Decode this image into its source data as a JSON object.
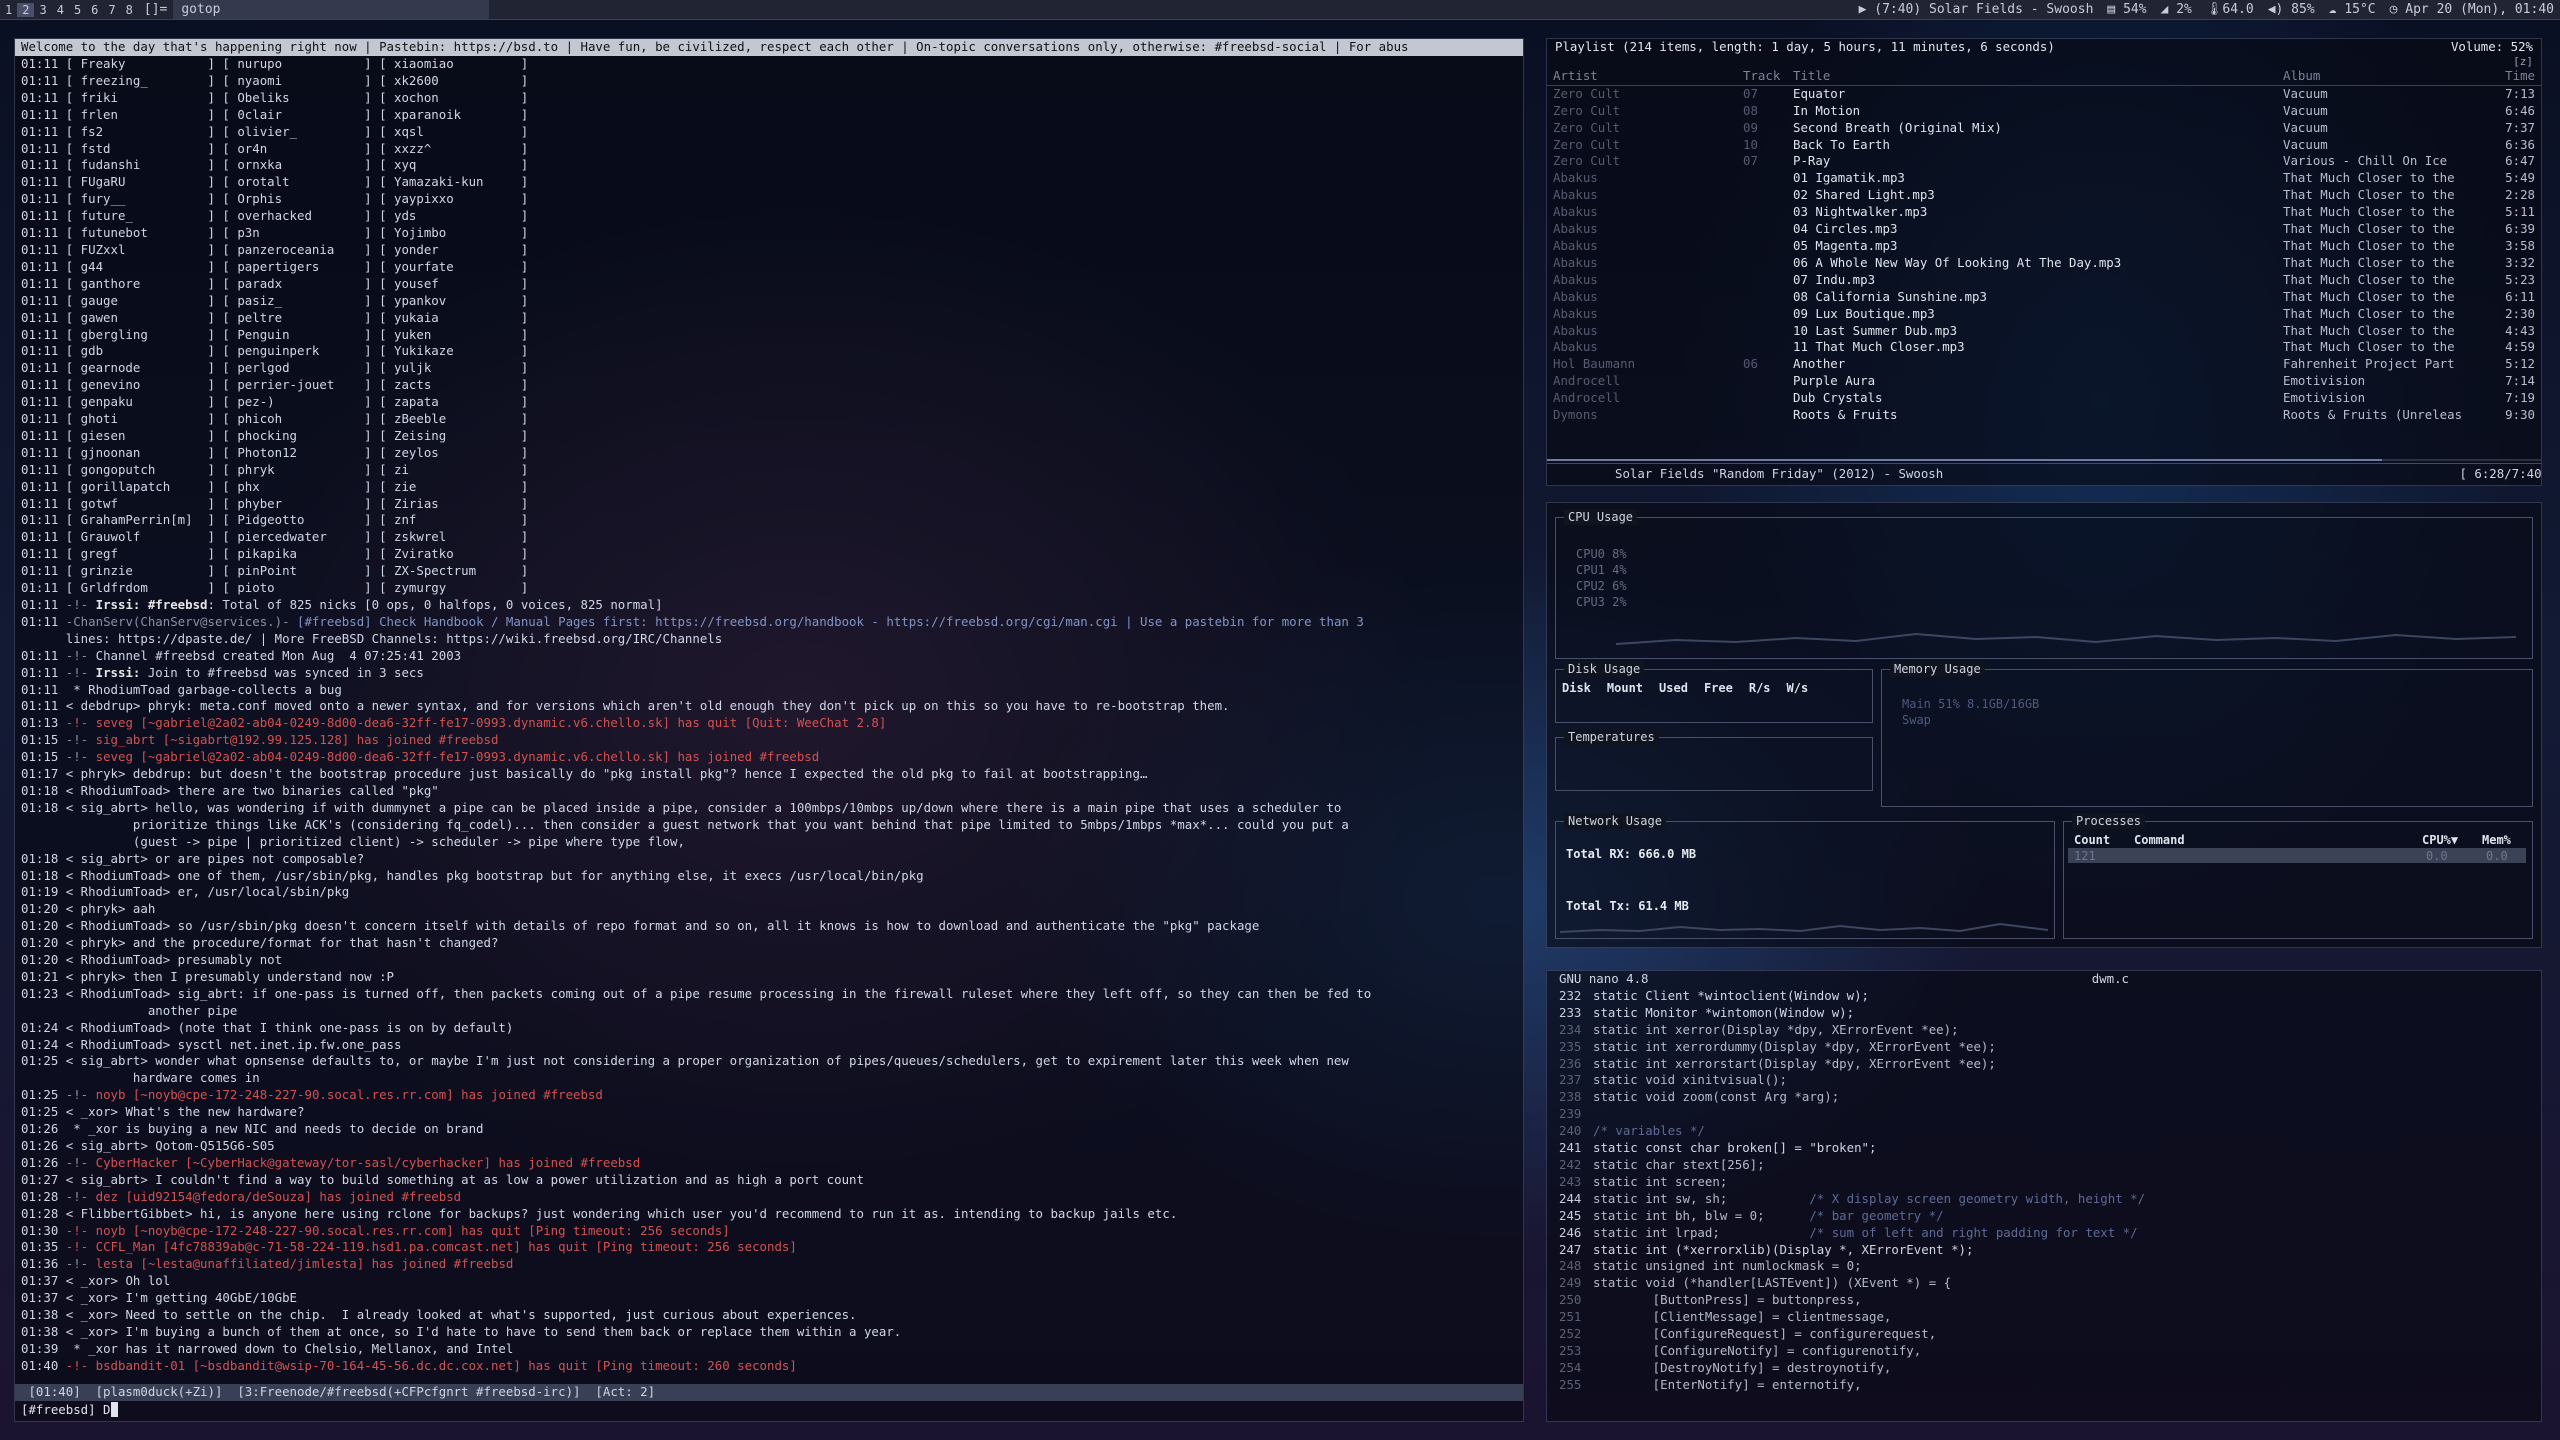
{
  "topbar": {
    "workspaces": [
      "1",
      "2",
      "3",
      "4",
      "5",
      "6",
      "7",
      "8"
    ],
    "active_workspace": "2",
    "layout": "[]=",
    "window_title": "gotop",
    "now_playing": "▶ (7:40) Solar Fields - Swoosh",
    "mem": "54%",
    "cpu": "2%",
    "temp": "64.0",
    "volume": "85%",
    "weather": "15°C",
    "datetime": "Apr 20 (Mon), 01:40"
  },
  "irc": {
    "topic": "Welcome to the day that's happening right now | Pastebin: https://bsd.to | Have fun, be civilized, respect each other | On-topic conversations only, otherwise: #freebsd-social | For abus",
    "names_rows": [
      [
        "Freaky",
        "nurupo",
        "xiaomiao"
      ],
      [
        "freezing_",
        "nyaomi",
        "xk2600"
      ],
      [
        "friki",
        "Obeliks",
        "xochon"
      ],
      [
        "frlen",
        "0clair",
        "xparanoik"
      ],
      [
        "fs2",
        "olivier_",
        "xqsl"
      ],
      [
        "fstd",
        "or4n",
        "xxzz^"
      ],
      [
        "fudanshi",
        "ornxka",
        "xyq"
      ],
      [
        "FUgaRU",
        "orotalt",
        "Yamazaki-kun"
      ],
      [
        "fury__",
        "Orphis",
        "yaypixxo"
      ],
      [
        "future_",
        "overhacked",
        "yds"
      ],
      [
        "futunebot",
        "p3n",
        "Yojimbo"
      ],
      [
        "FUZxxl",
        "panzeroceania",
        "yonder"
      ],
      [
        "g44",
        "papertigers",
        "yourfate"
      ],
      [
        "ganthore",
        "paradx",
        "yousef"
      ],
      [
        "gauge",
        "pasiz_",
        "ypankov"
      ],
      [
        "gawen",
        "peltre",
        "yukaia"
      ],
      [
        "gbergling",
        "Penguin",
        "yuken"
      ],
      [
        "gdb",
        "penguinperk",
        "Yukikaze"
      ],
      [
        "gearnode",
        "perlgod",
        "yuljk"
      ],
      [
        "genevino",
        "perrier-jouet",
        "zacts"
      ],
      [
        "genpaku",
        "pez-)",
        "zapata"
      ],
      [
        "ghoti",
        "phicoh",
        "zBeeble"
      ],
      [
        "giesen",
        "phocking",
        "Zeising"
      ],
      [
        "gjnoonan",
        "Photon12",
        "zeylos"
      ],
      [
        "gongoputch",
        "phryk",
        "zi"
      ],
      [
        "gorillapatch",
        "phx",
        "zie"
      ],
      [
        "gotwf",
        "phyber",
        "Zirias"
      ],
      [
        "GrahamPerrin[m]",
        "Pidgeotto",
        "znf"
      ],
      [
        "Grauwolf",
        "piercedwater",
        "zskwrel"
      ],
      [
        "gregf",
        "pikapika",
        "Zviratko"
      ],
      [
        "grinzie",
        "pinPoint",
        "ZX-Spectrum"
      ],
      [
        "Grldfrdom",
        "pioto",
        "zymurgy"
      ]
    ],
    "names_time": "01:11",
    "messages": [
      {
        "t": "01:11",
        "k": "sys",
        "s": "-!- ",
        "b": "Irssi: #freebsd",
        "r": ": Total of 825 nicks [0 ops, 0 halfops, 0 voices, 825 normal]"
      },
      {
        "t": "01:11",
        "k": "notice",
        "s": "-ChanServ(ChanServ@services.)- ",
        "r": "[#freebsd] Check Handbook / Manual Pages first: https://freebsd.org/handbook - https://freebsd.org/cgi/man.cgi | Use a pastebin for more than 3"
      },
      {
        "t": "",
        "k": "cont",
        "r": "      lines: https://dpaste.de/ | More FreeBSD Channels: https://wiki.freebsd.org/IRC/Channels"
      },
      {
        "t": "01:11",
        "k": "sys",
        "s": "-!- ",
        "r": "Channel #freebsd created Mon Aug  4 07:25:41 2003"
      },
      {
        "t": "01:11",
        "k": "sys",
        "s": "-!- ",
        "b": "Irssi: ",
        "r": "Join to #freebsd was synced in 3 secs"
      },
      {
        "t": "01:11",
        "k": "act",
        "r": " * RhodiumToad garbage-collects a bug"
      },
      {
        "t": "01:11",
        "k": "msg",
        "r": "< debdrup> phryk: meta.conf moved onto a newer syntax, and for versions which aren't old enough they don't pick up on this so you have to re-bootstrap them."
      },
      {
        "t": "01:13",
        "k": "quit",
        "s": "-!- ",
        "r": "seveg [~gabriel@2a02-ab04-0249-8d00-dea6-32ff-fe17-0993.dynamic.v6.chello.sk] has quit [Quit: WeeChat 2.8]"
      },
      {
        "t": "01:15",
        "k": "join",
        "s": "-!- ",
        "r": "sig_abrt [~sigabrt@192.99.125.128] has joined #freebsd"
      },
      {
        "t": "01:15",
        "k": "join",
        "s": "-!- ",
        "r": "seveg [~gabriel@2a02-ab04-0249-8d00-dea6-32ff-fe17-0993.dynamic.v6.chello.sk] has joined #freebsd"
      },
      {
        "t": "01:17",
        "k": "msg",
        "r": "< phryk> debdrup: but doesn't the bootstrap procedure just basically do \"pkg install pkg\"? hence I expected the old pkg to fail at bootstrapping…"
      },
      {
        "t": "01:18",
        "k": "msg",
        "r": "< RhodiumToad> there are two binaries called \"pkg\""
      },
      {
        "t": "01:18",
        "k": "msg",
        "r": "< sig_abrt> hello, was wondering if with dummynet a pipe can be placed inside a pipe, consider a 100mbps/10mbps up/down where there is a main pipe that uses a scheduler to"
      },
      {
        "t": "",
        "k": "cont",
        "r": "               prioritize things like ACK's (considering fq_codel)... then consider a guest network that you want behind that pipe limited to 5mbps/1mbps *max*... could you put a"
      },
      {
        "t": "",
        "k": "cont",
        "r": "               (guest -> pipe | prioritized client) -> scheduler -> pipe where type flow,"
      },
      {
        "t": "01:18",
        "k": "msg",
        "r": "< sig_abrt> or are pipes not composable?"
      },
      {
        "t": "01:18",
        "k": "msg",
        "r": "< RhodiumToad> one of them, /usr/sbin/pkg, handles pkg bootstrap but for anything else, it execs /usr/local/bin/pkg"
      },
      {
        "t": "01:19",
        "k": "msg",
        "r": "< RhodiumToad> er, /usr/local/sbin/pkg"
      },
      {
        "t": "01:20",
        "k": "msg",
        "r": "< phryk> aah"
      },
      {
        "t": "01:20",
        "k": "msg",
        "r": "< RhodiumToad> so /usr/sbin/pkg doesn't concern itself with details of repo format and so on, all it knows is how to download and authenticate the \"pkg\" package"
      },
      {
        "t": "01:20",
        "k": "msg",
        "r": "< phryk> and the procedure/format for that hasn't changed?"
      },
      {
        "t": "01:20",
        "k": "msg",
        "r": "< RhodiumToad> presumably not"
      },
      {
        "t": "01:21",
        "k": "msg",
        "r": "< phryk> then I presumably understand now :P"
      },
      {
        "t": "01:23",
        "k": "msg",
        "r": "< RhodiumToad> sig_abrt: if one-pass is turned off, then packets coming out of a pipe resume processing in the firewall ruleset where they left off, so they can then be fed to"
      },
      {
        "t": "",
        "k": "cont",
        "r": "                 another pipe"
      },
      {
        "t": "01:24",
        "k": "msg",
        "r": "< RhodiumToad> (note that I think one-pass is on by default)"
      },
      {
        "t": "01:24",
        "k": "msg",
        "r": "< RhodiumToad> sysctl net.inet.ip.fw.one_pass"
      },
      {
        "t": "01:25",
        "k": "msg",
        "r": "< sig_abrt> wonder what opnsense defaults to, or maybe I'm just not considering a proper organization of pipes/queues/schedulers, get to expirement later this week when new"
      },
      {
        "t": "",
        "k": "cont",
        "r": "               hardware comes in"
      },
      {
        "t": "01:25",
        "k": "join",
        "s": "-!- ",
        "r": "noyb [~noyb@cpe-172-248-227-90.socal.res.rr.com] has joined #freebsd"
      },
      {
        "t": "01:25",
        "k": "msg",
        "r": "< _xor> What's the new hardware?"
      },
      {
        "t": "01:26",
        "k": "act",
        "r": " * _xor is buying a new NIC and needs to decide on brand"
      },
      {
        "t": "01:26",
        "k": "msg",
        "r": "< sig_abrt> Qotom-Q515G6-S05"
      },
      {
        "t": "01:26",
        "k": "join",
        "s": "-!- ",
        "r": "CyberHacker [~CyberHack@gateway/tor-sasl/cyberhacker] has joined #freebsd"
      },
      {
        "t": "01:27",
        "k": "msg",
        "r": "< sig_abrt> I couldn't find a way to build something at as low a power utilization and as high a port count"
      },
      {
        "t": "01:28",
        "k": "join",
        "s": "-!- ",
        "r": "dez [uid92154@fedora/deSouza] has joined #freebsd"
      },
      {
        "t": "01:28",
        "k": "msg",
        "r": "< FlibbertGibbet> hi, is anyone here using rclone for backups? just wondering which user you'd recommend to run it as. intending to backup jails etc."
      },
      {
        "t": "01:30",
        "k": "quit",
        "s": "-!- ",
        "r": "noyb [~noyb@cpe-172-248-227-90.socal.res.rr.com] has quit [Ping timeout: 256 seconds]"
      },
      {
        "t": "01:35",
        "k": "quit",
        "s": "-!- ",
        "r": "CCFL_Man [4fc78839ab@c-71-58-224-119.hsd1.pa.comcast.net] has quit [Ping timeout: 256 seconds]"
      },
      {
        "t": "01:36",
        "k": "join",
        "s": "-!- ",
        "r": "lesta [~lesta@unaffiliated/jimlesta] has joined #freebsd"
      },
      {
        "t": "01:37",
        "k": "msg",
        "r": "< _xor> Oh lol"
      },
      {
        "t": "01:37",
        "k": "msg",
        "r": "< _xor> I'm getting 40GbE/10GbE"
      },
      {
        "t": "01:38",
        "k": "msg",
        "r": "< _xor> Need to settle on the chip.  I already looked at what's supported, just curious about experiences."
      },
      {
        "t": "01:38",
        "k": "msg",
        "r": "< _xor> I'm buying a bunch of them at once, so I'd hate to have to send them back or replace them within a year."
      },
      {
        "t": "01:39",
        "k": "act",
        "r": " * _xor has it narrowed down to Chelsio, Mellanox, and Intel"
      },
      {
        "t": "01:40",
        "k": "quit",
        "s": "-!- ",
        "r": "bsdbandit-01 [~bsdbandit@wsip-70-164-45-56.dc.dc.cox.net] has quit [Ping timeout: 260 seconds]"
      }
    ],
    "statusbar": " [01:40]  [plasm0duck(+Zi)]  [3:Freenode/#freebsd(+CFPcfgnrt #freebsd-irc)]  [Act: 2]",
    "prompt": "[#freebsd] D"
  },
  "playlist": {
    "header": "Playlist (214 items, length: 1 day, 5 hours, 11 minutes, 6 seconds)",
    "volume": "Volume: 52%",
    "mode": "[z]",
    "columns": [
      "Artist",
      "Track",
      "Title",
      "Album",
      "Time"
    ],
    "rows": [
      [
        "Zero Cult",
        "07",
        "Equator",
        "Vacuum",
        "7:13"
      ],
      [
        "Zero Cult",
        "08",
        "In Motion",
        "Vacuum",
        "6:46"
      ],
      [
        "Zero Cult",
        "09",
        "Second Breath (Original Mix)",
        "Vacuum",
        "7:37"
      ],
      [
        "Zero Cult",
        "10",
        "Back To Earth",
        "Vacuum",
        "6:36"
      ],
      [
        "Zero Cult",
        "07",
        "P-Ray",
        "Various - Chill On Ice",
        "6:47"
      ],
      [
        "Abakus",
        "",
        "01 Igamatik.mp3",
        "That Much Closer to the",
        "5:49"
      ],
      [
        "Abakus",
        "",
        "02 Shared Light.mp3",
        "That Much Closer to the",
        "2:28"
      ],
      [
        "Abakus",
        "",
        "03 Nightwalker.mp3",
        "That Much Closer to the",
        "5:11"
      ],
      [
        "Abakus",
        "",
        "04 Circles.mp3",
        "That Much Closer to the",
        "6:39"
      ],
      [
        "Abakus",
        "",
        "05 Magenta.mp3",
        "That Much Closer to the",
        "3:58"
      ],
      [
        "Abakus",
        "",
        "06 A Whole New Way Of Looking At The Day.mp3",
        "That Much Closer to the",
        "3:32"
      ],
      [
        "Abakus",
        "",
        "07 Indu.mp3",
        "That Much Closer to the",
        "5:23"
      ],
      [
        "Abakus",
        "",
        "08 California Sunshine.mp3",
        "That Much Closer to the",
        "6:11"
      ],
      [
        "Abakus",
        "",
        "09 Lux Boutique.mp3",
        "That Much Closer to the",
        "2:30"
      ],
      [
        "Abakus",
        "",
        "10 Last Summer Dub.mp3",
        "That Much Closer to the",
        "4:43"
      ],
      [
        "Abakus",
        "",
        "11 That Much Closer.mp3",
        "That Much Closer to the",
        "4:59"
      ],
      [
        "Hol Baumann",
        "06",
        "Another",
        "Fahrenheit Project Part",
        "5:12"
      ],
      [
        "Androcell",
        "",
        "Purple Aura",
        "Emotivision",
        "7:14"
      ],
      [
        "Androcell",
        "",
        "Dub Crystals",
        "Emotivision",
        "7:19"
      ],
      [
        "Dymons",
        "",
        "Roots & Fruits",
        "Roots & Fruits (Unreleas",
        "9:30"
      ]
    ],
    "now_playing": "Solar Fields \"Random Friday\" (2012) - Swoosh",
    "progress": "[ 6:28/7:40]",
    "progress_fraction": 0.84
  },
  "gotop": {
    "cpu_title": "CPU Usage",
    "cpus": [
      [
        "CPU0",
        "8%"
      ],
      [
        "CPU1",
        "4%"
      ],
      [
        "CPU2",
        "6%"
      ],
      [
        "CPU3",
        "2%"
      ]
    ],
    "disk_title": "Disk Usage",
    "disk_cols": [
      "Disk",
      "Mount",
      "Used",
      "Free",
      "R/s",
      "W/s"
    ],
    "mem_title": "Memory Usage",
    "mem_main": "Main  51%  8.1GB/16GB",
    "mem_swap": "Swap",
    "temp_title": "Temperatures",
    "net_title": "Network Usage",
    "net_rx": "Total RX: 666.0 MB",
    "net_tx": "Total Tx:  61.4 MB",
    "proc_title": "Processes",
    "proc_cols": [
      "Count",
      "Command",
      "CPU%▼",
      "Mem%"
    ],
    "proc_row": [
      "121",
      "",
      "0.0",
      "0.0"
    ]
  },
  "nano": {
    "title": "GNU nano 4.8",
    "filename": "dwm.c",
    "lines": [
      [
        "232",
        "static Client *wintoclient(Window w);"
      ],
      [
        "233",
        "static Monitor *wintomon(Window w);"
      ],
      [
        "234",
        "static int xerror(Display *dpy, XErrorEvent *ee);"
      ],
      [
        "235",
        "static int xerrordummy(Display *dpy, XErrorEvent *ee);"
      ],
      [
        "236",
        "static int xerrorstart(Display *dpy, XErrorEvent *ee);"
      ],
      [
        "237",
        "static void xinitvisual();"
      ],
      [
        "238",
        "static void zoom(const Arg *arg);"
      ],
      [
        "239",
        ""
      ],
      [
        "240",
        "/* variables */"
      ],
      [
        "241",
        "static const char broken[] = \"broken\";"
      ],
      [
        "242",
        "static char stext[256];"
      ],
      [
        "243",
        "static int screen;"
      ],
      [
        "244",
        "static int sw, sh;           /* X display screen geometry width, height */"
      ],
      [
        "245",
        "static int bh, blw = 0;      /* bar geometry */"
      ],
      [
        "246",
        "static int lrpad;            /* sum of left and right padding for text */"
      ],
      [
        "247",
        "static int (*xerrorxlib)(Display *, XErrorEvent *);"
      ],
      [
        "248",
        "static unsigned int numlockmask = 0;"
      ],
      [
        "249",
        "static void (*handler[LASTEvent]) (XEvent *) = {"
      ],
      [
        "250",
        "        [ButtonPress] = buttonpress,"
      ],
      [
        "251",
        "        [ClientMessage] = clientmessage,"
      ],
      [
        "252",
        "        [ConfigureRequest] = configurerequest,"
      ],
      [
        "253",
        "        [ConfigureNotify] = configurenotify,"
      ],
      [
        "254",
        "        [DestroyNotify] = destroynotify,"
      ],
      [
        "255",
        "        [EnterNotify] = enternotify,"
      ]
    ]
  }
}
